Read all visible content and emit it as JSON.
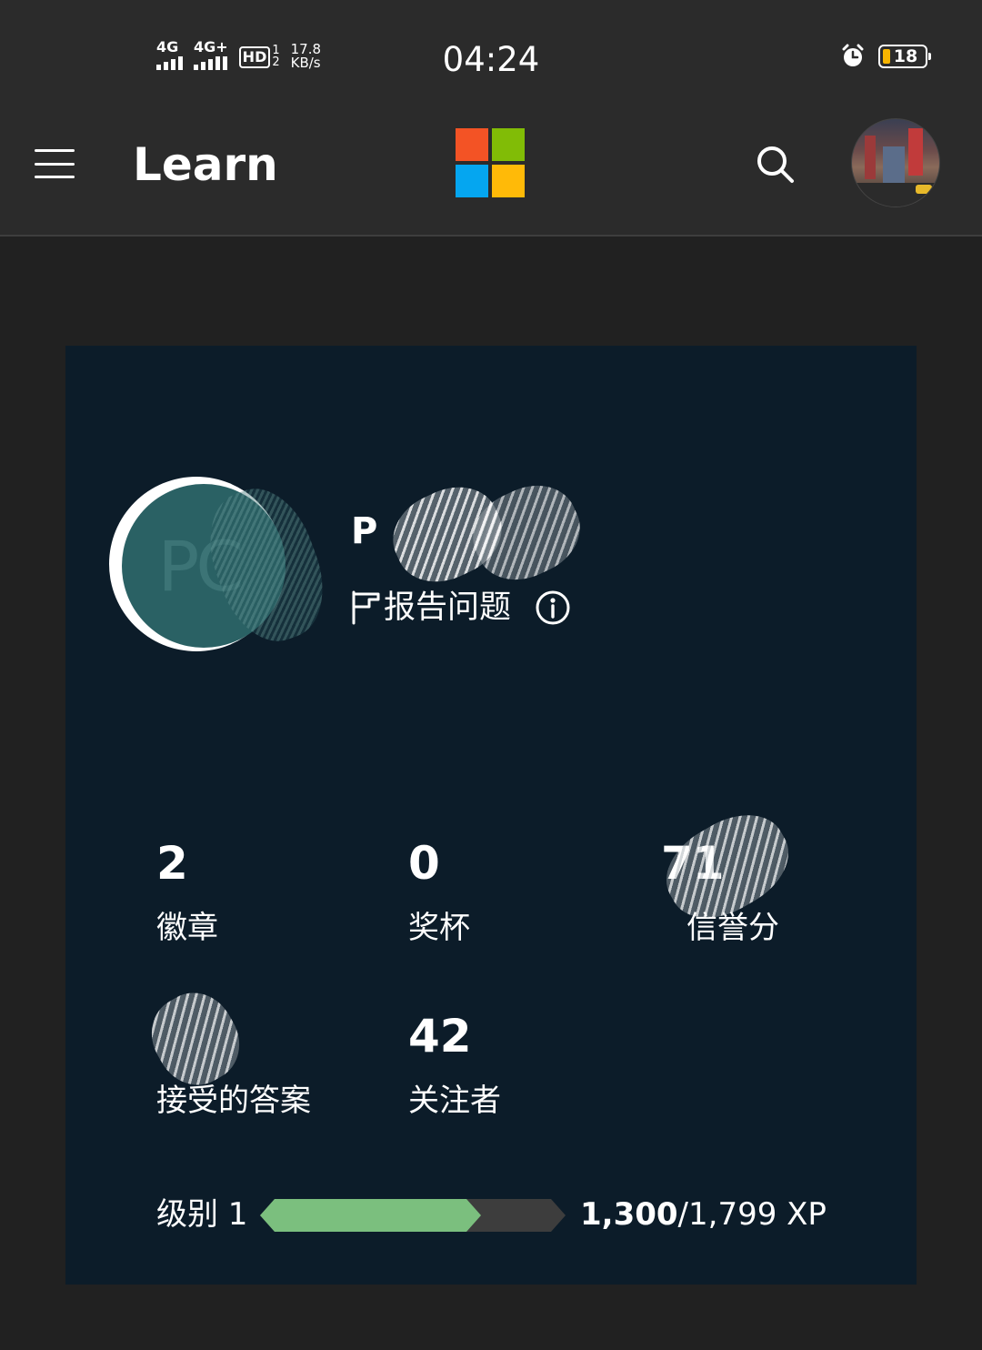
{
  "status_bar": {
    "network1": "4G",
    "network2": "4G+",
    "hd": "HD",
    "hd_sim1": "1",
    "hd_sim2": "2",
    "speed_value": "17.8",
    "speed_unit": "KB/s",
    "time": "04:24",
    "battery": "18",
    "battery_level": 0.18,
    "icons": [
      "signal-icon",
      "alarm-icon",
      "battery-icon"
    ]
  },
  "header": {
    "title": "Learn",
    "icons": [
      "menu-icon",
      "microsoft-logo",
      "search-icon",
      "account-avatar"
    ],
    "logo_colors": [
      "#f35325",
      "#81bc06",
      "#05a6f0",
      "#ffba08"
    ]
  },
  "profile": {
    "initials": "PC",
    "name": "P",
    "report_label": "报告问题"
  },
  "stats": [
    {
      "value": "2",
      "label": "徽章"
    },
    {
      "value": "0",
      "label": "奖杯"
    },
    {
      "value": "71",
      "label": "信誉分"
    },
    {
      "value": "",
      "label": "接受的答案"
    },
    {
      "value": "42",
      "label": "关注者"
    }
  ],
  "level": {
    "label": "级别 1",
    "xp_current": "1,300",
    "xp_total": "/1,799 XP",
    "progress": 0.723
  },
  "colors": {
    "card_bg": "#0c1c29",
    "progress_fill": "#7bbf7e",
    "avatar_bg": "#2a6164"
  }
}
